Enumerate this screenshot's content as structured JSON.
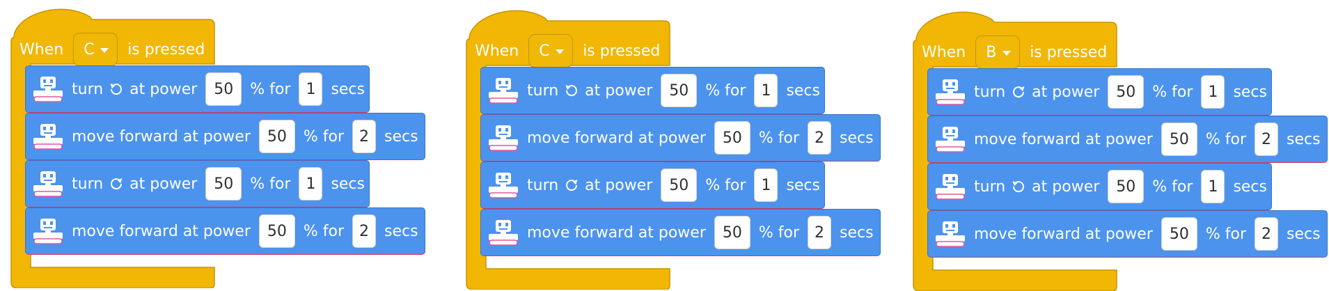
{
  "colors": {
    "event_block": "#f2b705",
    "event_block_border": "#c79400",
    "motion_block": "#4c93ee",
    "motion_block_border": "#3674c8",
    "block_bottom_edge": "#d9355c",
    "input_background": "#ffffff",
    "text_light": "#ffffff",
    "text_dark": "#2f2f2f"
  },
  "icons": {
    "robot": "robot-icon",
    "rotate_left": "rotate-counterclockwise-icon",
    "rotate_right": "rotate-clockwise-icon",
    "dropdown": "chevron-down-icon"
  },
  "scripts": [
    {
      "hat": {
        "when": "When",
        "button": "C",
        "is_pressed": "is pressed"
      },
      "blocks": [
        {
          "kind": "turn",
          "direction": "counterclockwise",
          "turn_label": "turn",
          "power_label": "at power",
          "power": "50",
          "for_label": "% for",
          "duration": "1",
          "unit": "secs"
        },
        {
          "kind": "move",
          "move_label": "move forward at power",
          "power": "50",
          "for_label": "% for",
          "duration": "2",
          "unit": "secs"
        },
        {
          "kind": "turn",
          "direction": "clockwise",
          "turn_label": "turn",
          "power_label": "at power",
          "power": "50",
          "for_label": "% for",
          "duration": "1",
          "unit": "secs"
        },
        {
          "kind": "move",
          "move_label": "move forward at power",
          "power": "50",
          "for_label": "% for",
          "duration": "2",
          "unit": "secs"
        }
      ]
    },
    {
      "hat": {
        "when": "When",
        "button": "C",
        "is_pressed": "is pressed"
      },
      "blocks": [
        {
          "kind": "turn",
          "direction": "counterclockwise",
          "turn_label": "turn",
          "power_label": "at power",
          "power": "50",
          "for_label": "% for",
          "duration": "1",
          "unit": "secs"
        },
        {
          "kind": "move",
          "move_label": "move forward at power",
          "power": "50",
          "for_label": "% for",
          "duration": "2",
          "unit": "secs"
        },
        {
          "kind": "turn",
          "direction": "clockwise",
          "turn_label": "turn",
          "power_label": "at power",
          "power": "50",
          "for_label": "% for",
          "duration": "1",
          "unit": "secs"
        },
        {
          "kind": "move",
          "move_label": "move forward at power",
          "power": "50",
          "for_label": "% for",
          "duration": "2",
          "unit": "secs"
        }
      ]
    },
    {
      "hat": {
        "when": "When",
        "button": "B",
        "is_pressed": "is pressed"
      },
      "blocks": [
        {
          "kind": "turn",
          "direction": "clockwise",
          "turn_label": "turn",
          "power_label": "at power",
          "power": "50",
          "for_label": "% for",
          "duration": "1",
          "unit": "secs"
        },
        {
          "kind": "move",
          "move_label": "move forward at power",
          "power": "50",
          "for_label": "% for",
          "duration": "2",
          "unit": "secs"
        },
        {
          "kind": "turn",
          "direction": "counterclockwise",
          "turn_label": "turn",
          "power_label": "at power",
          "power": "50",
          "for_label": "% for",
          "duration": "1",
          "unit": "secs"
        },
        {
          "kind": "move",
          "move_label": "move forward at power",
          "power": "50",
          "for_label": "% for",
          "duration": "2",
          "unit": "secs"
        }
      ]
    }
  ]
}
